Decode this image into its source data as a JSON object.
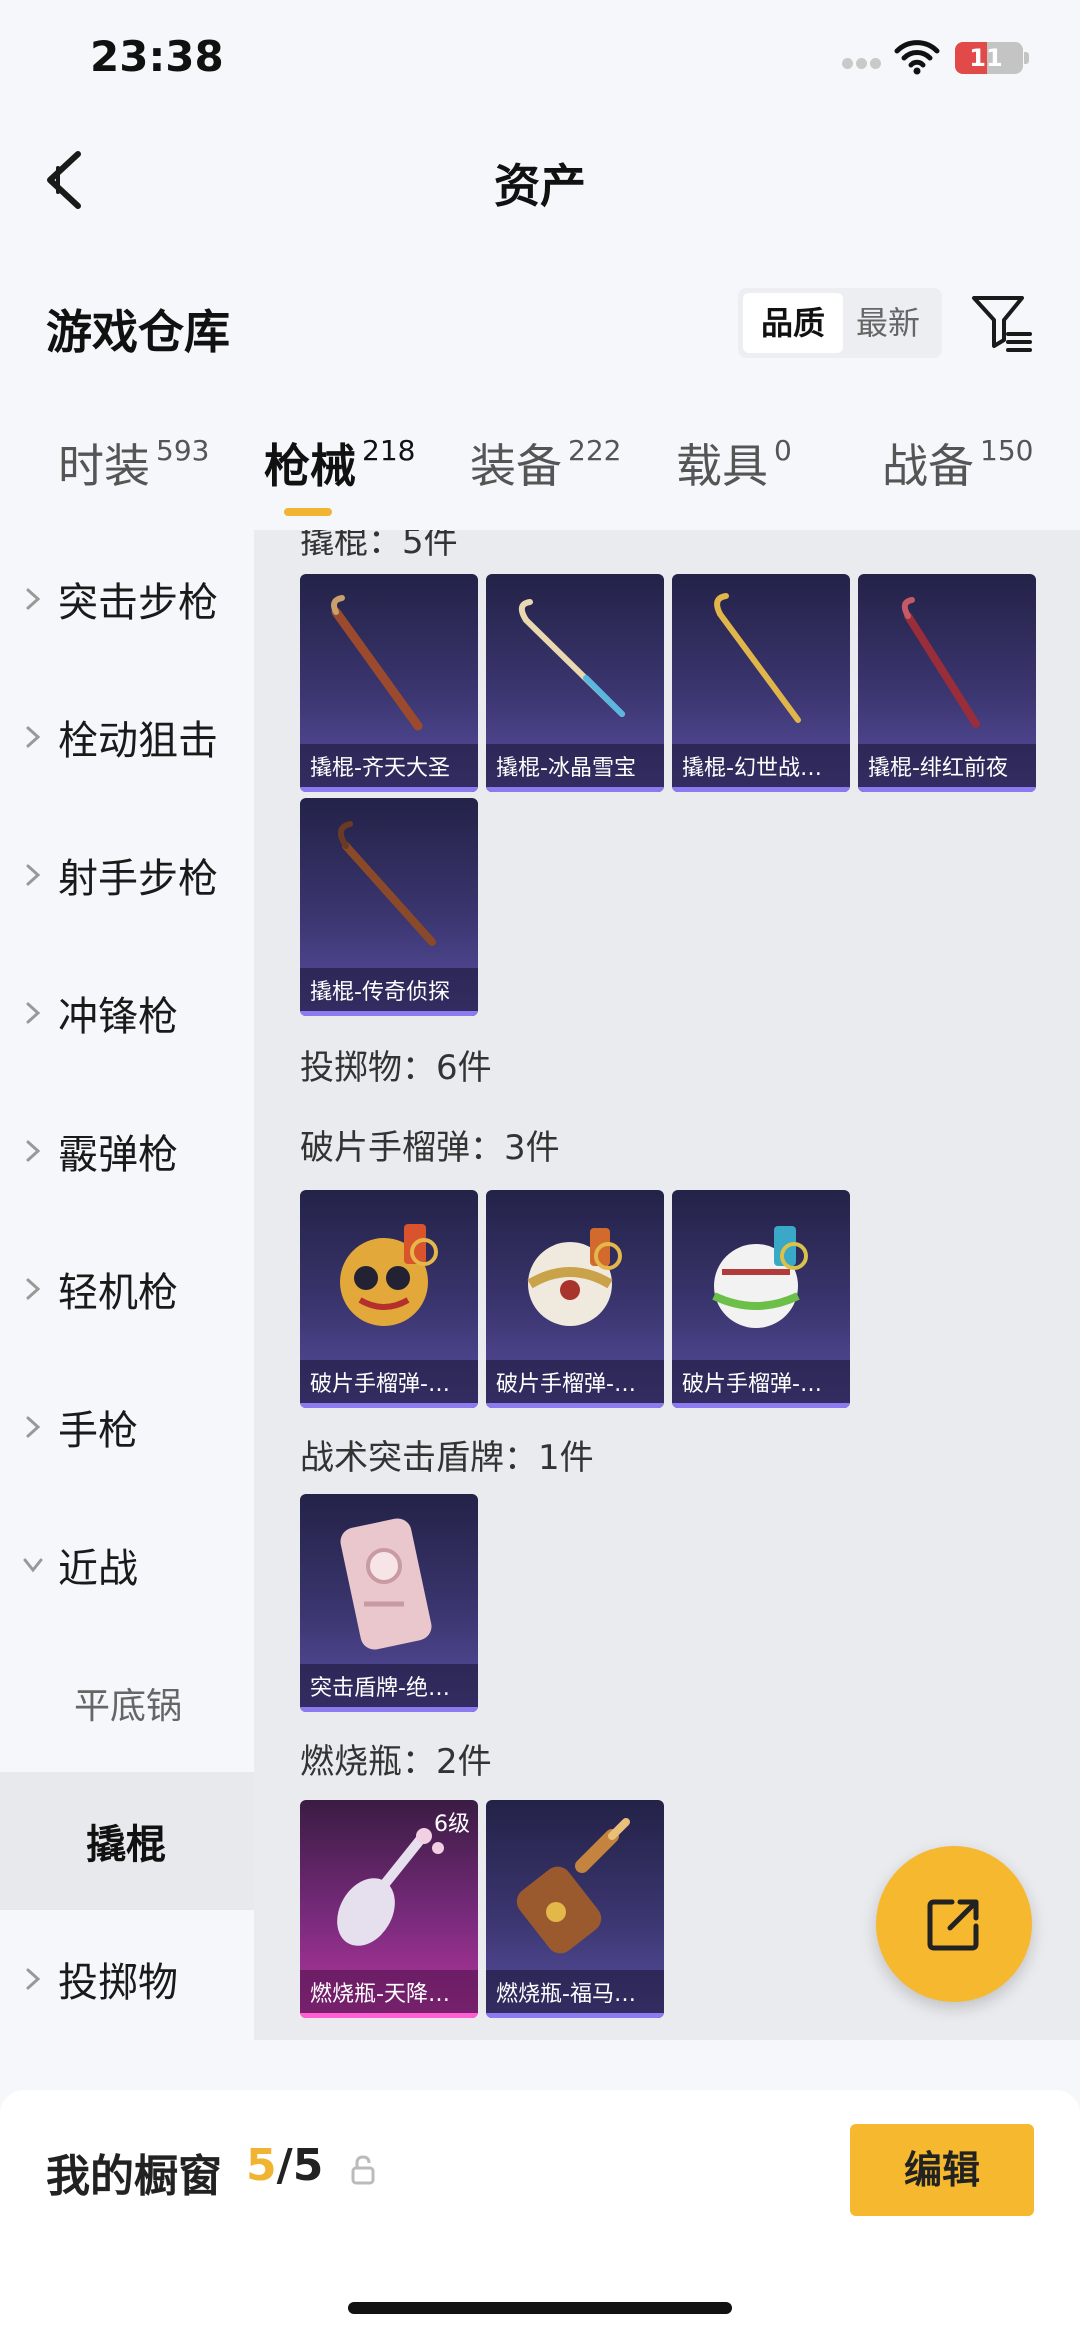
{
  "status_bar": {
    "time": "23:38",
    "battery": "11"
  },
  "nav": {
    "title": "资产"
  },
  "section": {
    "title": "游戏仓库",
    "sort_options": [
      "品质",
      "最新"
    ]
  },
  "tabs": [
    {
      "label": "时装",
      "count": "593"
    },
    {
      "label": "枪械",
      "count": "218"
    },
    {
      "label": "装备",
      "count": "222"
    },
    {
      "label": "载具",
      "count": "0"
    },
    {
      "label": "战备",
      "count": "150"
    }
  ],
  "sidebar": [
    {
      "label": "突击步枪"
    },
    {
      "label": "栓动狙击"
    },
    {
      "label": "射手步枪"
    },
    {
      "label": "冲锋枪"
    },
    {
      "label": "霰弹枪"
    },
    {
      "label": "轻机枪"
    },
    {
      "label": "手枪"
    },
    {
      "label": "近战"
    },
    {
      "label": "平底锅"
    },
    {
      "label": "撬棍"
    },
    {
      "label": "投掷物"
    }
  ],
  "groups": {
    "crowbar_head": "撬棍：5件",
    "throwables_head": "投掷物：6件",
    "grenade_head": "破片手榴弹：3件",
    "shield_head": "战术突击盾牌：1件",
    "molotov_head": "燃烧瓶：2件"
  },
  "cards": [
    {
      "name": "撬棍-齐天大圣"
    },
    {
      "name": "撬棍-冰晶雪宝"
    },
    {
      "name": "撬棍-幻世战…"
    },
    {
      "name": "撬棍-绯红前夜"
    },
    {
      "name": "撬棍-传奇侦探"
    },
    {
      "name": "破片手榴弹-…"
    },
    {
      "name": "破片手榴弹-…"
    },
    {
      "name": "破片手榴弹-…"
    },
    {
      "name": "突击盾牌-绝…"
    },
    {
      "name": "燃烧瓶-天降…",
      "level": "6级"
    },
    {
      "name": "燃烧瓶-福马…"
    }
  ],
  "showcase": {
    "label": "我的橱窗",
    "current": "5",
    "total": "/5",
    "edit_label": "编辑"
  },
  "colors": {
    "accent": "#f5b82e",
    "card_purple": "#3b3670",
    "card_pink": "#b8369e"
  }
}
